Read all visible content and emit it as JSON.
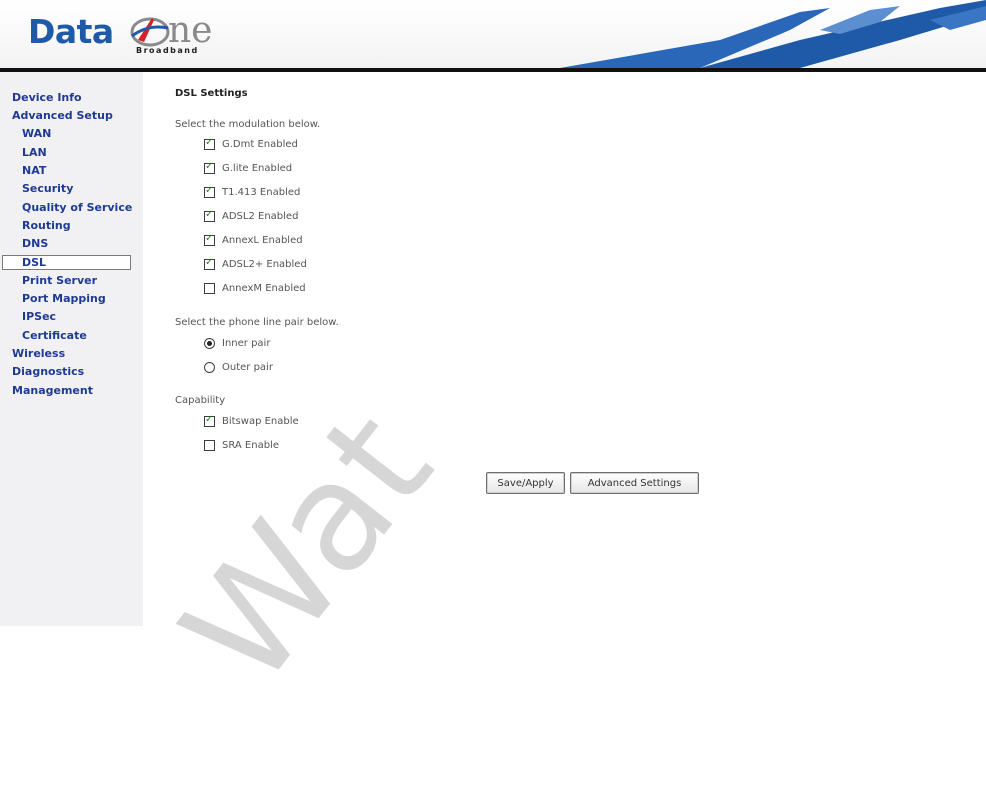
{
  "header": {
    "logo_text_left": "Data",
    "logo_text_right": "ne",
    "logo_tagline": "Broadband"
  },
  "sidebar": {
    "items": [
      {
        "label": "Device Info",
        "level": "top"
      },
      {
        "label": "Advanced Setup",
        "level": "top"
      },
      {
        "label": "WAN",
        "level": "sub"
      },
      {
        "label": "LAN",
        "level": "sub"
      },
      {
        "label": "NAT",
        "level": "sub"
      },
      {
        "label": "Security",
        "level": "sub"
      },
      {
        "label": "Quality of Service",
        "level": "sub"
      },
      {
        "label": "Routing",
        "level": "sub"
      },
      {
        "label": "DNS",
        "level": "sub"
      },
      {
        "label": "DSL",
        "level": "sub",
        "active": true
      },
      {
        "label": "Print Server",
        "level": "sub"
      },
      {
        "label": "Port Mapping",
        "level": "sub"
      },
      {
        "label": "IPSec",
        "level": "sub"
      },
      {
        "label": "Certificate",
        "level": "sub"
      },
      {
        "label": "Wireless",
        "level": "top"
      },
      {
        "label": "Diagnostics",
        "level": "top"
      },
      {
        "label": "Management",
        "level": "top"
      }
    ]
  },
  "main": {
    "title": "DSL Settings",
    "modulation_label": "Select the modulation below.",
    "modulations": [
      {
        "label": "G.Dmt Enabled",
        "checked": true
      },
      {
        "label": "G.lite Enabled",
        "checked": true
      },
      {
        "label": "T1.413 Enabled",
        "checked": true
      },
      {
        "label": "ADSL2 Enabled",
        "checked": true
      },
      {
        "label": "AnnexL Enabled",
        "checked": true
      },
      {
        "label": "ADSL2+ Enabled",
        "checked": true
      },
      {
        "label": "AnnexM Enabled",
        "checked": false
      }
    ],
    "phone_pair_label": "Select the phone line pair below.",
    "phone_pairs": [
      {
        "label": "Inner pair",
        "selected": true
      },
      {
        "label": "Outer pair",
        "selected": false
      }
    ],
    "capability_label": "Capability",
    "capabilities": [
      {
        "label": "Bitswap Enable",
        "checked": true
      },
      {
        "label": "SRA Enable",
        "checked": false
      }
    ],
    "save_label": "Save/Apply",
    "advanced_label": "Advanced Settings"
  },
  "watermark": "Wat",
  "colors": {
    "brand_blue": "#1e5aa8",
    "nav_link": "#1f3a93",
    "sidebar_bg": "#f1f1f3",
    "check_green": "#1c8a1c"
  }
}
